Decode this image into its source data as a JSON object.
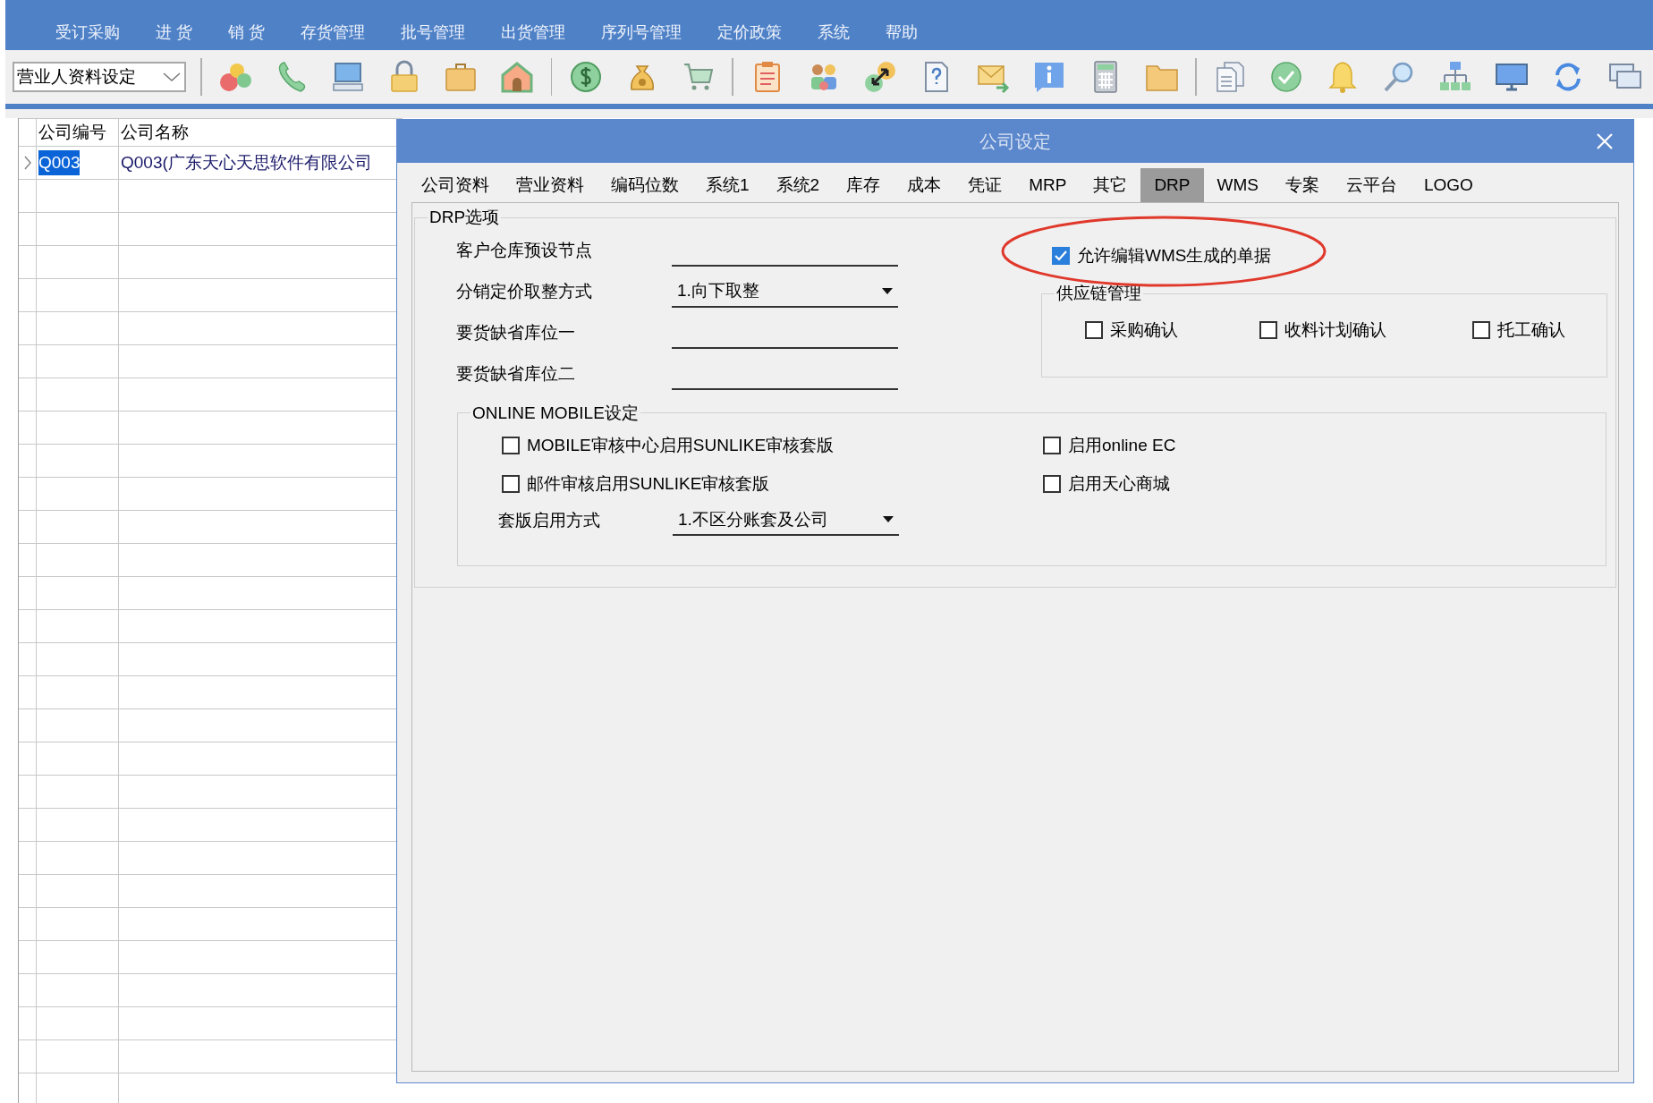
{
  "menu": [
    "受订采购",
    "进 货",
    "销 货",
    "存货管理",
    "批号管理",
    "出货管理",
    "序列号管理",
    "定价政策",
    "系统",
    "帮助"
  ],
  "toolbar": {
    "combo": {
      "value": "营业人资料设定"
    }
  },
  "table": {
    "columns": [
      "公司编号",
      "公司名称"
    ],
    "rows": [
      {
        "cells": [
          "Q003",
          "Q003(广东天心天思软件有限公司"
        ],
        "selected": true
      }
    ]
  },
  "dialog": {
    "title": "公司设定",
    "tabs": [
      {
        "label": "公司资料",
        "selected": false
      },
      {
        "label": "营业资料",
        "selected": false
      },
      {
        "label": "编码位数",
        "selected": false
      },
      {
        "label": "系统1",
        "selected": false
      },
      {
        "label": "系统2",
        "selected": false
      },
      {
        "label": "库存",
        "selected": false
      },
      {
        "label": "成本",
        "selected": false
      },
      {
        "label": "凭证",
        "selected": false
      },
      {
        "label": "MRP",
        "selected": false
      },
      {
        "label": "其它",
        "selected": false
      },
      {
        "label": "DRP",
        "selected": true
      },
      {
        "label": "WMS",
        "selected": false
      },
      {
        "label": "专案",
        "selected": false
      },
      {
        "label": "云平台",
        "selected": false
      },
      {
        "label": "LOGO",
        "selected": false
      }
    ],
    "drp_options": {
      "legend": "DRP选项",
      "fields": [
        {
          "label": "客户仓库预设节点",
          "kind": "text"
        },
        {
          "label": "分销定价取整方式",
          "kind": "dropdown",
          "value": "1.向下取整"
        },
        {
          "label": "要货缺省库位一",
          "kind": "text"
        },
        {
          "label": "要货缺省库位二",
          "kind": "text"
        }
      ],
      "allow_edit_wms": {
        "label": "允许编辑WMS生成的单据",
        "checked": true
      },
      "supply_chain": {
        "legend": "供应链管理",
        "options": [
          {
            "label": "采购确认",
            "checked": false
          },
          {
            "label": "收料计划确认",
            "checked": false
          },
          {
            "label": "托工确认",
            "checked": false
          }
        ]
      },
      "online_mobile": {
        "legend": "ONLINE MOBILE设定",
        "options": [
          {
            "label": "MOBILE审核中心启用SUNLIKE审核套版",
            "checked": false
          },
          {
            "label": "启用online EC",
            "checked": false
          },
          {
            "label": "邮件审核启用SUNLIKE审核套版",
            "checked": false
          },
          {
            "label": "启用天心商城",
            "checked": false
          }
        ],
        "template_mode": {
          "label": "套版启用方式",
          "value": "1.不区分账套及公司"
        }
      }
    }
  }
}
